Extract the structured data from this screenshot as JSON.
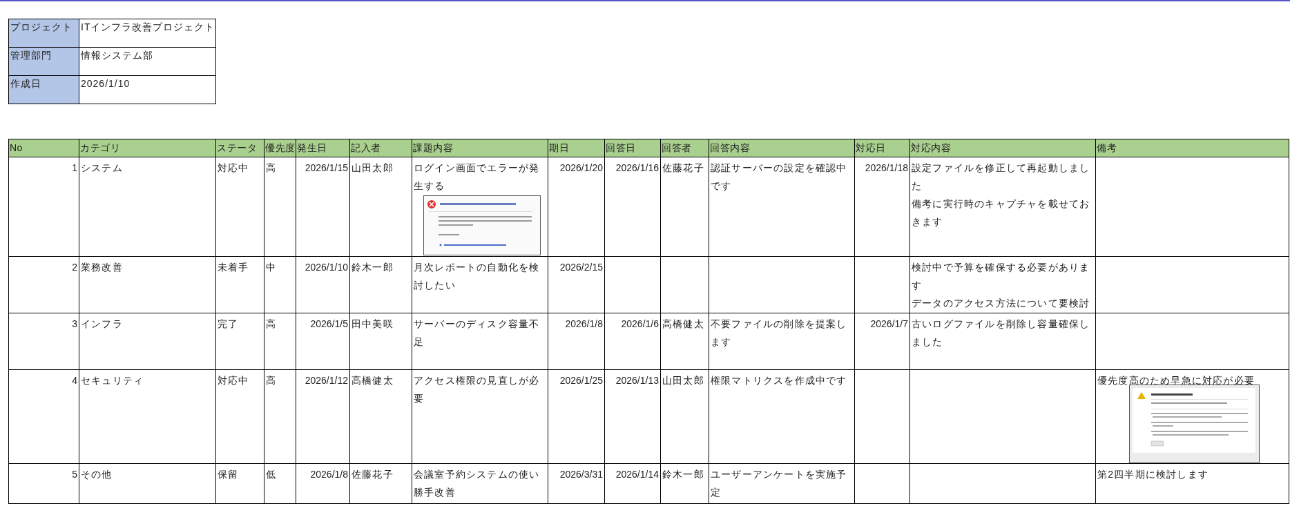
{
  "project_info": [
    {
      "label": "プロジェクト",
      "value": "ITインフラ改善プロジェクト"
    },
    {
      "label": "管理部門",
      "value": "情報システム部"
    },
    {
      "label": "作成日",
      "value": "2026/1/10"
    }
  ],
  "table": {
    "columns": [
      {
        "label": "No",
        "kind": "numeric"
      },
      {
        "label": "カテゴリ",
        "kind": "plain"
      },
      {
        "label": "ステータ",
        "kind": "plain"
      },
      {
        "label": "優先度",
        "kind": "plain"
      },
      {
        "label": "発生日",
        "kind": "numeric"
      },
      {
        "label": "記入者",
        "kind": "plain"
      },
      {
        "label": "課題内容",
        "kind": "plain"
      },
      {
        "label": "期日",
        "kind": "numeric"
      },
      {
        "label": "回答日",
        "kind": "numeric"
      },
      {
        "label": "回答者",
        "kind": "plain"
      },
      {
        "label": "回答内容",
        "kind": "plain"
      },
      {
        "label": "対応日",
        "kind": "numeric"
      },
      {
        "label": "対応内容",
        "kind": "plain"
      },
      {
        "label": "備考",
        "kind": "plain"
      }
    ],
    "rows": [
      {
        "cells": [
          "1",
          "システム",
          "対応中",
          "高",
          "2026/1/15",
          "山田太郎",
          {
            "text": "ログイン画面でエラーが発生する",
            "attachment": {
              "kind": "error"
            }
          },
          "2026/1/20",
          "2026/1/16",
          "佐藤花子",
          "認証サーバーの設定を確認中です",
          "2026/1/18",
          {
            "lines": [
              "設定ファイルを修正して再起動しました",
              "備考に実行時のキャプチャを載せておきます"
            ]
          },
          null
        ]
      },
      {
        "cells": [
          "2",
          "業務改善",
          "未着手",
          "中",
          "2026/1/10",
          "鈴木一郎",
          "月次レポートの自動化を検討したい",
          "2026/2/15",
          null,
          null,
          null,
          null,
          {
            "lines": [
              "検討中で予算を確保する必要があります",
              "データのアクセス方法について要検討"
            ]
          },
          null
        ]
      },
      {
        "cells": [
          "3",
          "インフラ",
          "完了",
          "高",
          "2026/1/5",
          "田中美咲",
          "サーバーのディスク容量不足",
          "2026/1/8",
          "2026/1/6",
          "高橋健太",
          "不要ファイルの削除を提案します",
          "2026/1/7",
          "古いログファイルを削除し容量確保しました",
          null
        ]
      },
      {
        "cells": [
          "4",
          "セキュリティ",
          "対応中",
          "高",
          "2026/1/12",
          "高橋健太",
          "アクセス権限の見直しが必要",
          "2026/1/25",
          "2026/1/13",
          "山田太郎",
          "権限マトリクスを作成中です",
          null,
          null,
          {
            "text": "優先度高のため早急に対応が必要",
            "attachment": {
              "kind": "warning"
            }
          }
        ]
      },
      {
        "cells": [
          "5",
          "その他",
          "保留",
          "低",
          "2026/1/8",
          "佐藤花子",
          "会議室予約システムの使い勝手改善",
          "2026/3/31",
          "2026/1/14",
          "鈴木一郎",
          "ユーザーアンケートを実施予定",
          null,
          null,
          "第2四半期に検討します"
        ]
      }
    ]
  }
}
